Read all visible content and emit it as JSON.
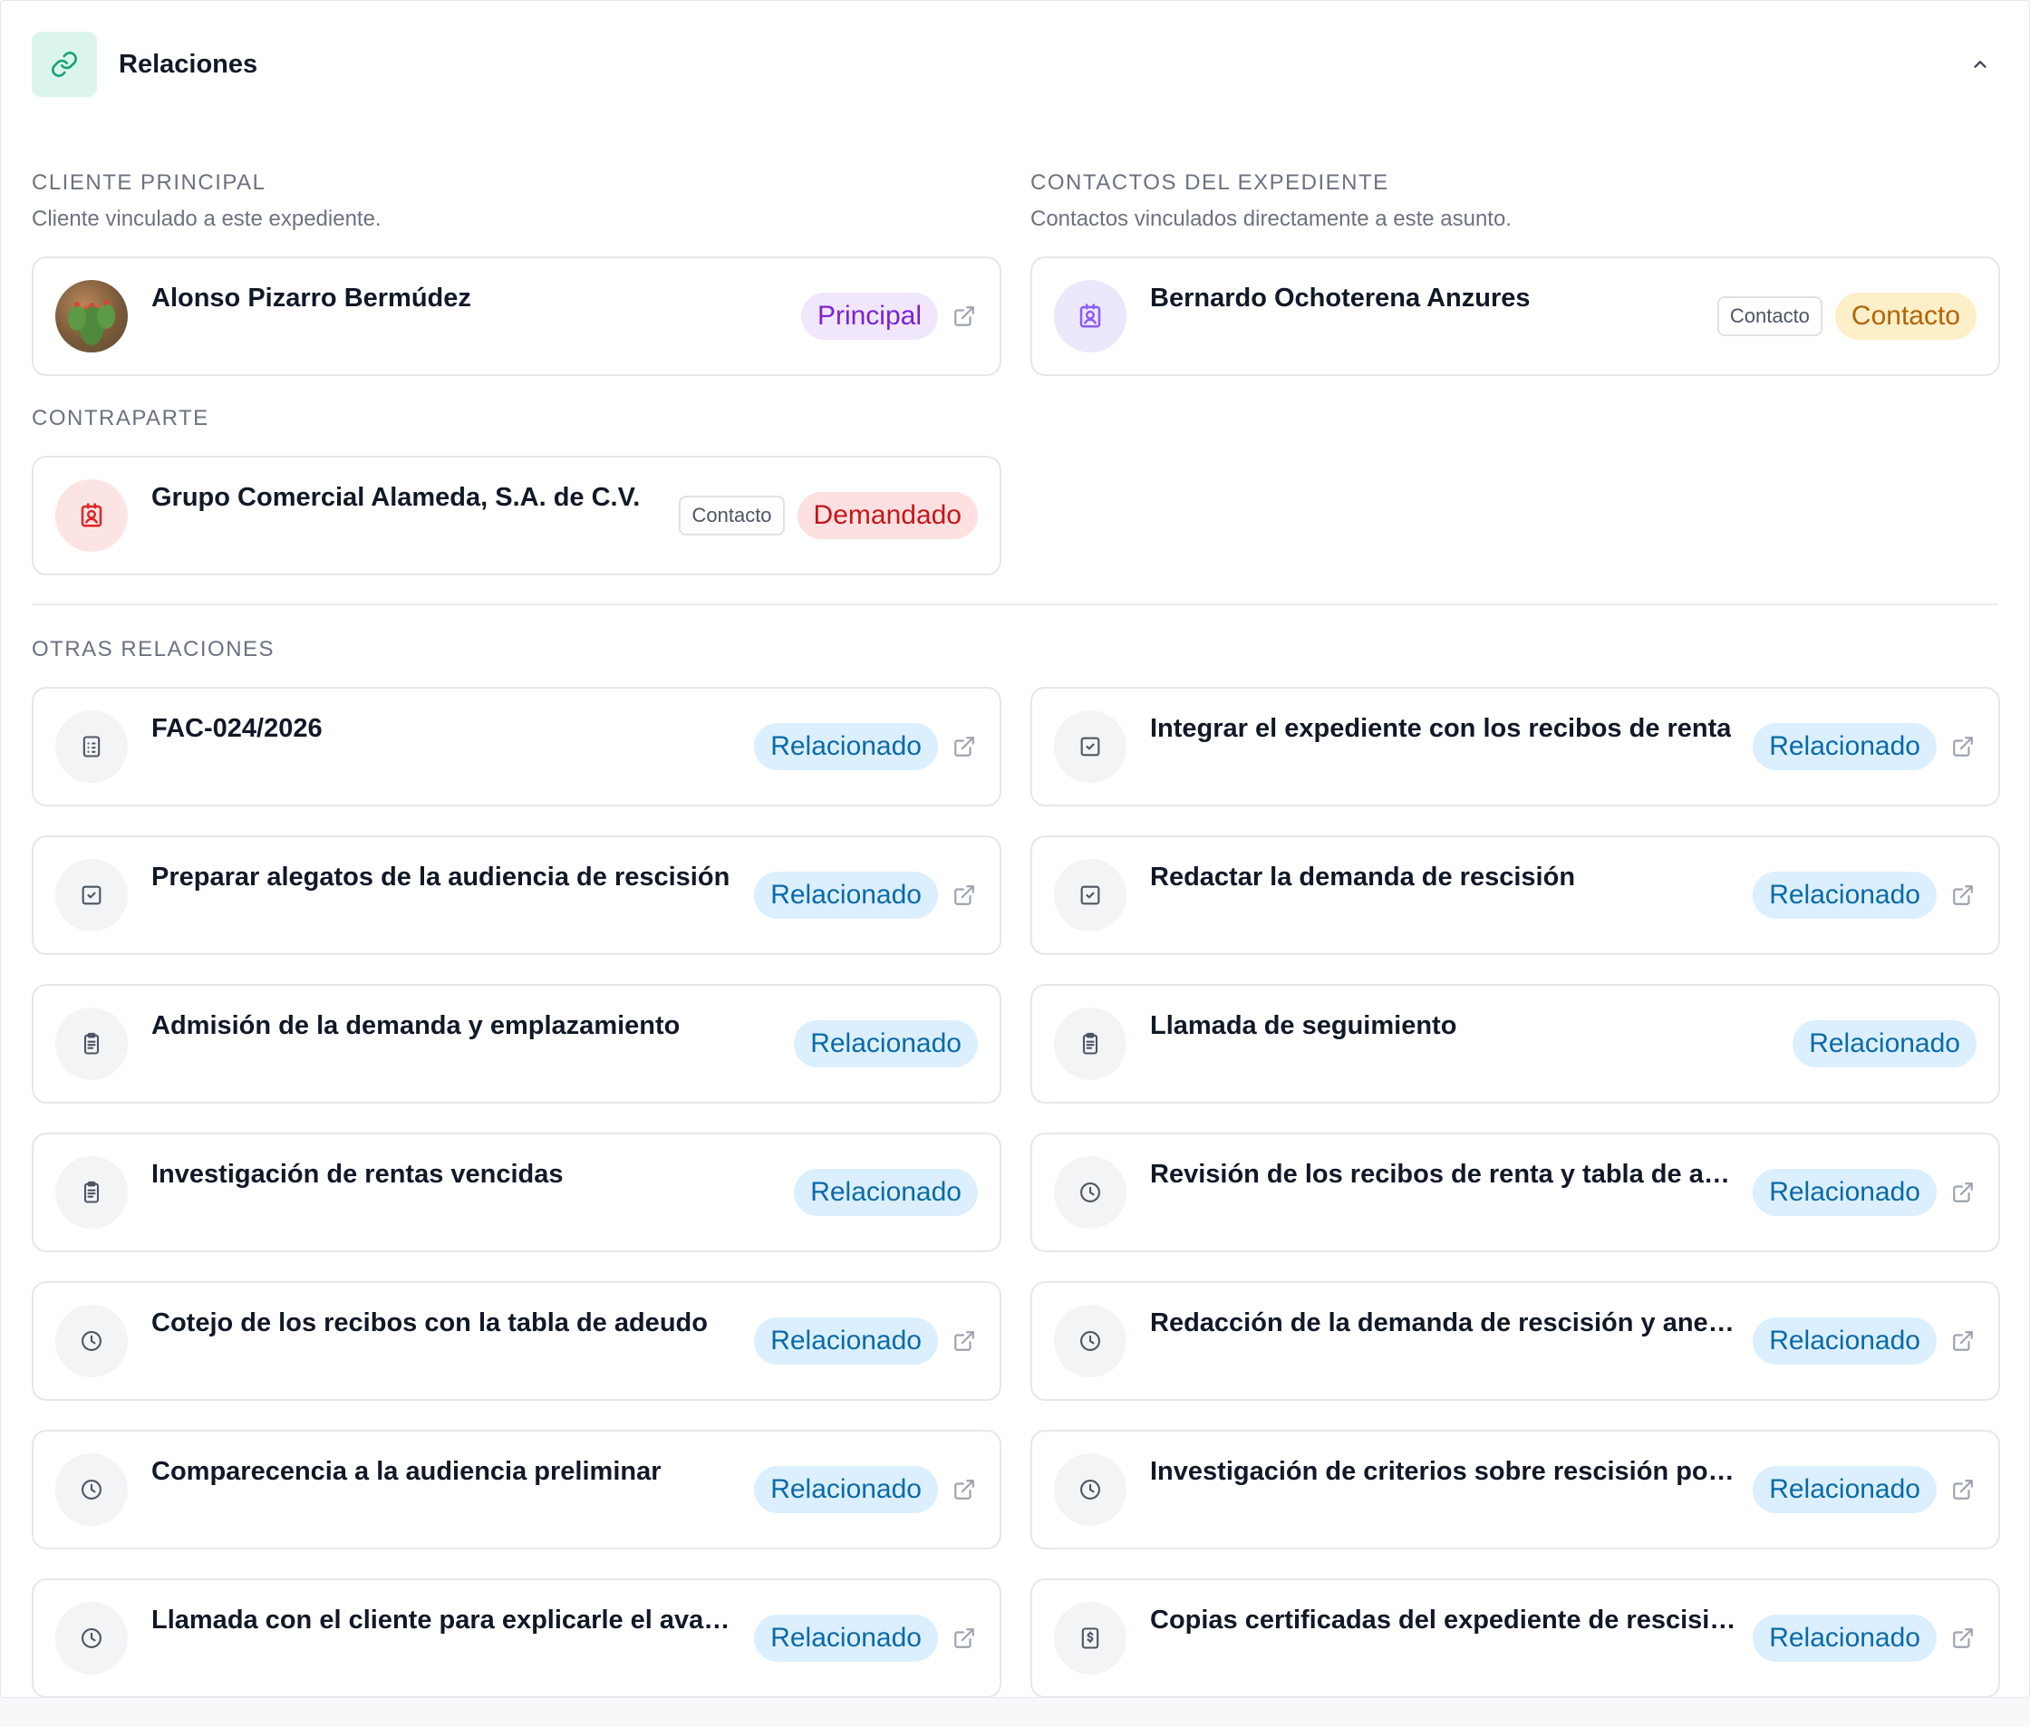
{
  "header": {
    "title": "Relaciones"
  },
  "cliente_principal": {
    "title": "CLIENTE PRINCIPAL",
    "description": "Cliente vinculado a este expediente.",
    "card": {
      "name": "Alonso Pizarro Bermúdez",
      "badge": "Principal"
    }
  },
  "contactos": {
    "title": "CONTACTOS DEL EXPEDIENTE",
    "description": "Contactos vinculados directamente a este asunto.",
    "card": {
      "name": "Bernardo Ochoterena Anzures",
      "tag": "Contacto",
      "badge": "Contacto"
    }
  },
  "contraparte": {
    "title": "CONTRAPARTE",
    "card": {
      "name": "Grupo Comercial Alameda, S.A. de C.V.",
      "tag": "Contacto",
      "badge": "Demandado"
    }
  },
  "otras": {
    "title": "OTRAS RELACIONES",
    "items": [
      {
        "name": "FAC-024/2026",
        "badge": "Relacionado",
        "icon": "invoice-icon"
      },
      {
        "name": "Integrar el expediente con los recibos de renta",
        "badge": "Relacionado",
        "icon": "task-check-icon"
      },
      {
        "name": "Preparar alegatos de la audiencia de rescisión",
        "badge": "Relacionado",
        "icon": "task-check-icon"
      },
      {
        "name": "Redactar la demanda de rescisión",
        "badge": "Relacionado",
        "icon": "task-check-icon"
      },
      {
        "name": "Admisión de la demanda y emplazamiento",
        "badge": "Relacionado",
        "icon": "clipboard-icon"
      },
      {
        "name": "Llamada de seguimiento",
        "badge": "Relacionado",
        "icon": "clipboard-icon"
      },
      {
        "name": "Investigación de rentas vencidas",
        "badge": "Relacionado",
        "icon": "clipboard-icon"
      },
      {
        "name": "Revisión de los recibos de renta y tabla de ad...",
        "badge": "Relacionado",
        "icon": "clock-icon"
      },
      {
        "name": "Cotejo de los recibos con la tabla de adeudo",
        "badge": "Relacionado",
        "icon": "clock-icon"
      },
      {
        "name": "Redacción de la demanda de rescisión y anexos",
        "badge": "Relacionado",
        "icon": "clock-icon"
      },
      {
        "name": "Comparecencia a la audiencia preliminar",
        "badge": "Relacionado",
        "icon": "clock-icon"
      },
      {
        "name": "Investigación de criterios sobre rescisión por ...",
        "badge": "Relacionado",
        "icon": "clock-icon"
      },
      {
        "name": "Llamada con el cliente para explicarle el avan...",
        "badge": "Relacionado",
        "icon": "clock-icon"
      },
      {
        "name": "Copias certificadas del expediente de rescisión",
        "badge": "Relacionado",
        "icon": "receipt-dollar-icon"
      }
    ]
  }
}
